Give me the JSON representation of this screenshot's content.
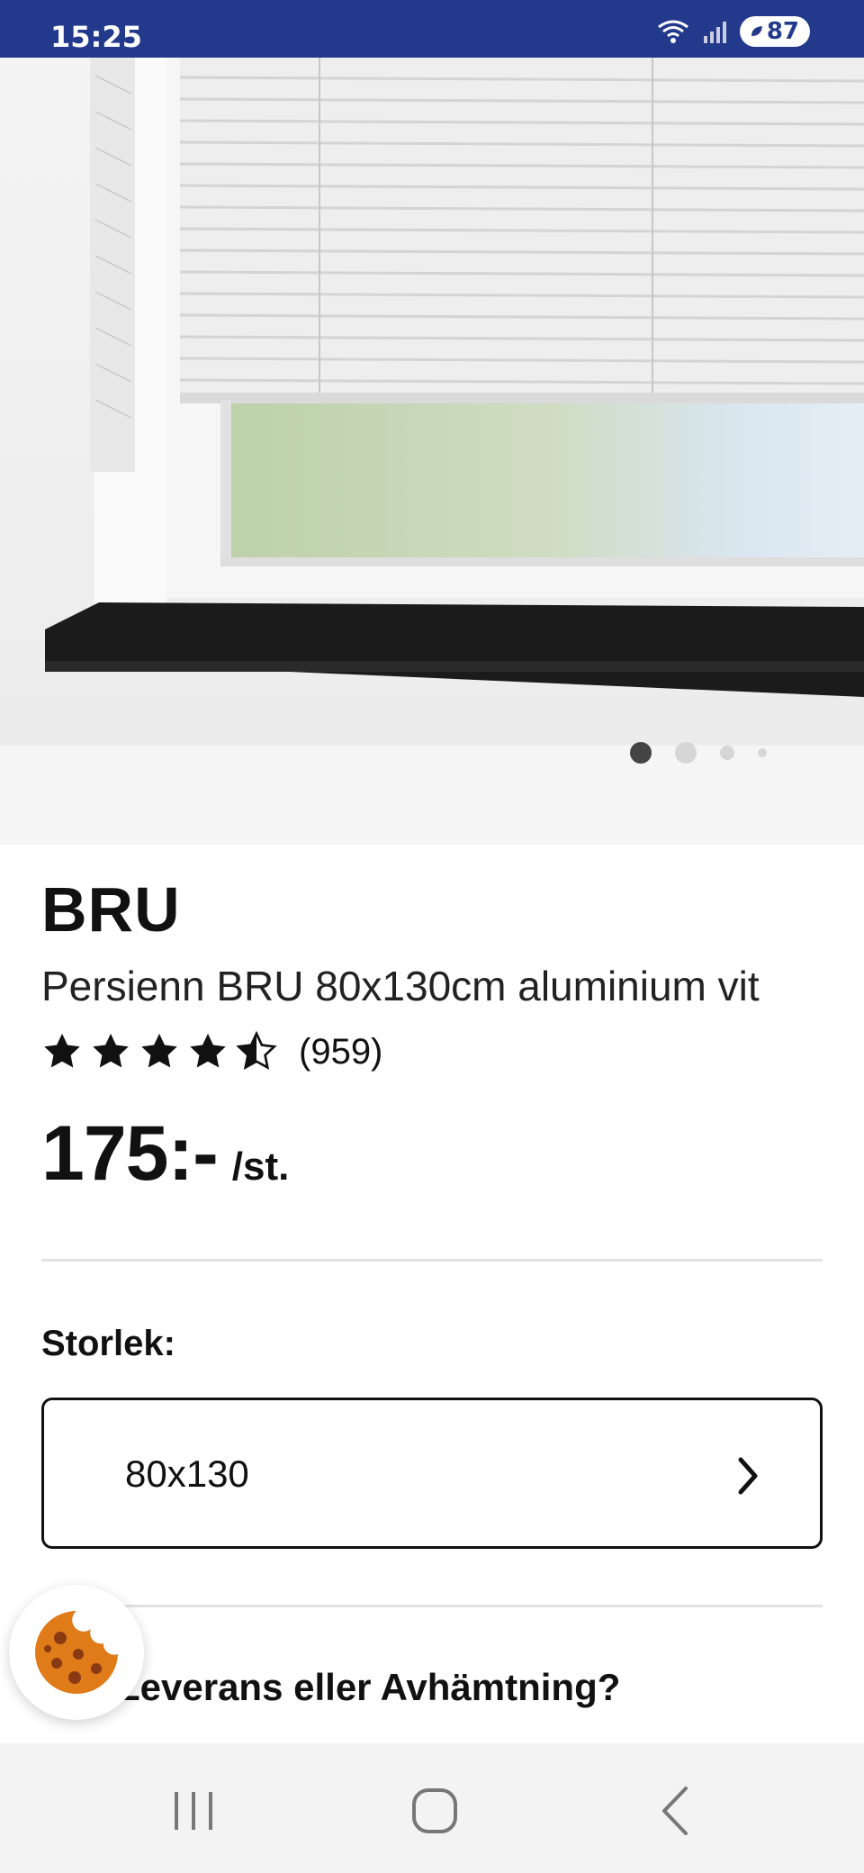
{
  "status_bar": {
    "time": "15:25",
    "battery": "87",
    "wifi_icon": "wifi-icon",
    "signal_icon": "signal-icon",
    "background": "#233a8c"
  },
  "carousel": {
    "total": 4,
    "active": 1
  },
  "product": {
    "brand": "BRU",
    "subtitle": "Persienn BRU 80x130cm aluminium vit",
    "rating": 4.5,
    "rating_max": 5,
    "review_count": "(959)",
    "price": "175:-",
    "price_unit": "/st."
  },
  "size": {
    "label": "Storlek:",
    "value": "80x130"
  },
  "delivery": {
    "label": "Leverans eller Avhämtning?"
  },
  "nav": {
    "recent_icon": "recent-apps-icon",
    "home_icon": "home-icon",
    "back_icon": "back-icon"
  }
}
